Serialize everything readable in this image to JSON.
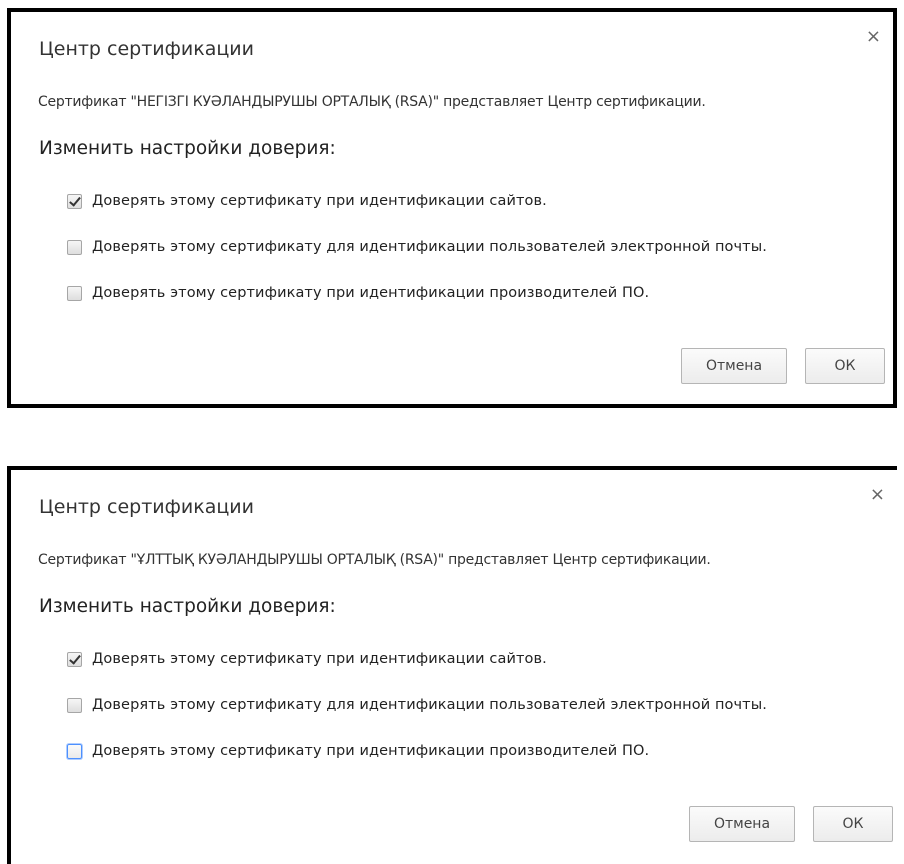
{
  "dialogs": [
    {
      "title": "Центр сертификации",
      "close_glyph": "×",
      "description": "Сертификат \"НЕГІЗГІ КУӘЛАНДЫРУШЫ ОРТАЛЫҚ (RSA)\" представляет Центр сертификации.",
      "heading": "Изменить настройки доверия:",
      "options": [
        {
          "label": "Доверять этому сертификату при идентификации сайтов.",
          "checked": true
        },
        {
          "label": "Доверять этому сертификату для идентификации пользователей электронной почты.",
          "checked": false
        },
        {
          "label": "Доверять этому сертификату при идентификации производителей ПО.",
          "checked": false
        }
      ],
      "cancel_label": "Отмена",
      "ok_label": "ОК"
    },
    {
      "title": "Центр сертификации",
      "close_glyph": "×",
      "description": "Сертификат \"ҰЛТТЫҚ КУӘЛАНДЫРУШЫ ОРТАЛЫҚ (RSA)\" представляет Центр сертификации.",
      "heading": "Изменить настройки доверия:",
      "options": [
        {
          "label": "Доверять этому сертификату при идентификации сайтов.",
          "checked": true
        },
        {
          "label": "Доверять этому сертификату для идентификации пользователей электронной почты.",
          "checked": false
        },
        {
          "label": "Доверять этому сертификату при идентификации производителей ПО.",
          "checked": false,
          "focused": true
        }
      ],
      "cancel_label": "Отмена",
      "ok_label": "ОК"
    }
  ],
  "colors": {
    "frame_border": "#000000",
    "focus_ring": "#4d90fe",
    "button_border": "#b5b5b5"
  }
}
